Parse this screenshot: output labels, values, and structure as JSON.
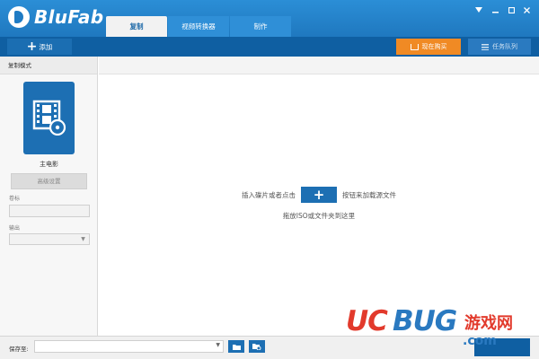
{
  "app": {
    "name": "BluFab",
    "tabs": [
      {
        "label": "复制",
        "active": true
      },
      {
        "label": "视频转换器",
        "active": false
      },
      {
        "label": "制作",
        "active": false
      }
    ],
    "window_controls": [
      "menu",
      "minimize",
      "maximize",
      "close"
    ]
  },
  "toolbar": {
    "add_label": "添加",
    "buy_label": "现在购买",
    "queue_label": "任务队列"
  },
  "left_panel": {
    "header": "复制模式",
    "mode_card_icon": "film-disc-icon",
    "mode_label": "主电影",
    "advanced_button": "高级设置",
    "title_label": "卷标",
    "title_value": "",
    "output_label": "输出",
    "output_value": ""
  },
  "main": {
    "hint_before": "插入碟片或者点击",
    "hint_after": "按钮来加载源文件",
    "hint_line2": "拖放ISO或文件夹到这里"
  },
  "bottom": {
    "save_label": "保存至:",
    "save_value": ""
  },
  "watermark": {
    "uc": "UC",
    "bug": "BUG",
    "cn": "游戏网",
    "com": ".com"
  },
  "colors": {
    "titlebar": "#1f78bf",
    "toolbar": "#0f5fa2",
    "accent_blue": "#1d6fb3",
    "buy_orange": "#f08a24"
  }
}
